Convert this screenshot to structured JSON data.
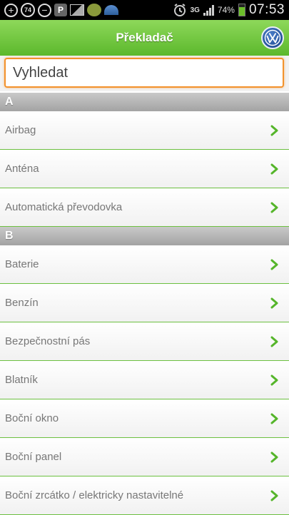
{
  "status_bar": {
    "left_icons": [
      "plus-icon",
      "notification-count-icon",
      "minus-circle-icon",
      "parking-icon",
      "image-icon",
      "chat-bubble-icon",
      "arch-app-icon"
    ],
    "notification_count": "74",
    "parking_letter": "P",
    "network": "3G",
    "battery_percent": "74%",
    "battery_level": 0.74,
    "time": "07:53"
  },
  "header": {
    "title": "Překladač",
    "accent_color": "#6cc040"
  },
  "search": {
    "placeholder": "Vyhledat",
    "value": ""
  },
  "sections": [
    {
      "letter": "A",
      "items": [
        "Airbag",
        "Anténa",
        "Automatická převodovka"
      ]
    },
    {
      "letter": "B",
      "items": [
        "Baterie",
        "Benzín",
        "Bezpečnostní pás",
        "Blatník",
        "Boční okno",
        "Boční panel",
        "Boční zrcátko / elektricky nastavitelné"
      ]
    }
  ]
}
